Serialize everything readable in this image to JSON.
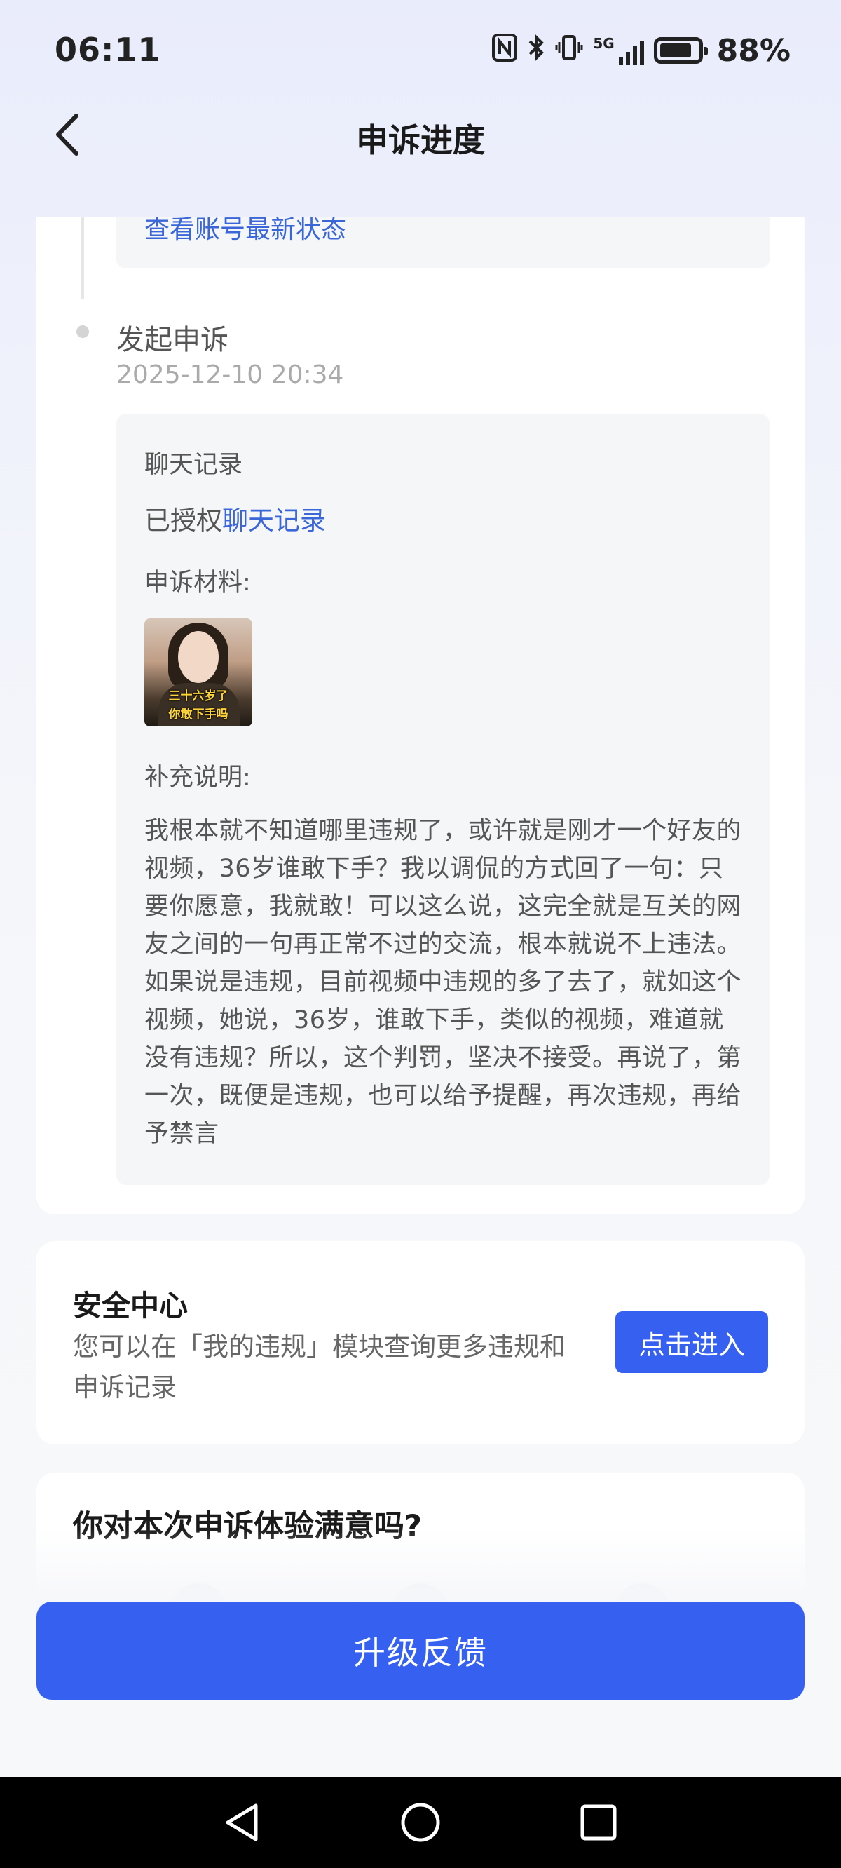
{
  "status_bar": {
    "time": "06:11",
    "network": "5G",
    "battery_percent": "88%",
    "icons": [
      "nfc-icon",
      "bluetooth-icon",
      "vibrate-icon",
      "signal-icon",
      "battery-icon"
    ]
  },
  "header": {
    "title": "申诉进度",
    "back_icon": "chevron-left-icon"
  },
  "timeline": {
    "prev_link": "查看账号最新状态",
    "event": {
      "title": "发起申诉",
      "time": "2025-12-10 20:34"
    },
    "detail": {
      "chat_label": "聊天记录",
      "auth_prefix": "已授权",
      "auth_link": "聊天记录",
      "materials_label": "申诉材料:",
      "thumbnail_caption_1": "三十六岁了",
      "thumbnail_caption_2": "你敢下手吗",
      "supplement_label": "补充说明:",
      "supplement_text": "我根本就不知道哪里违规了，或许就是刚才一个好友的视频，36岁谁敢下手？我以调侃的方式回了一句：只要你愿意，我就敢！可以这么说，这完全就是互关的网友之间的一句再正常不过的交流，根本就说不上违法。如果说是违规，目前视频中违规的多了去了，就如这个视频，她说，36岁，谁敢下手，类似的视频，难道就没有违规？所以，这个判罚，坚决不接受。再说了，第一次，既便是违规，也可以给予提醒，再次违规，再给予禁言"
    }
  },
  "safety_center": {
    "title": "安全中心",
    "description": "您可以在「我的违规」模块查询更多违规和申诉记录",
    "button": "点击进入"
  },
  "survey": {
    "question": "你对本次申诉体验满意吗?"
  },
  "upgrade_button": "升级反馈",
  "nav": {
    "back_icon": "nav-back-icon",
    "home_icon": "nav-home-icon",
    "recent_icon": "nav-recents-icon"
  },
  "colors": {
    "accent": "#3560f0",
    "link": "#3a66d8",
    "background": "#f6f7fa"
  }
}
